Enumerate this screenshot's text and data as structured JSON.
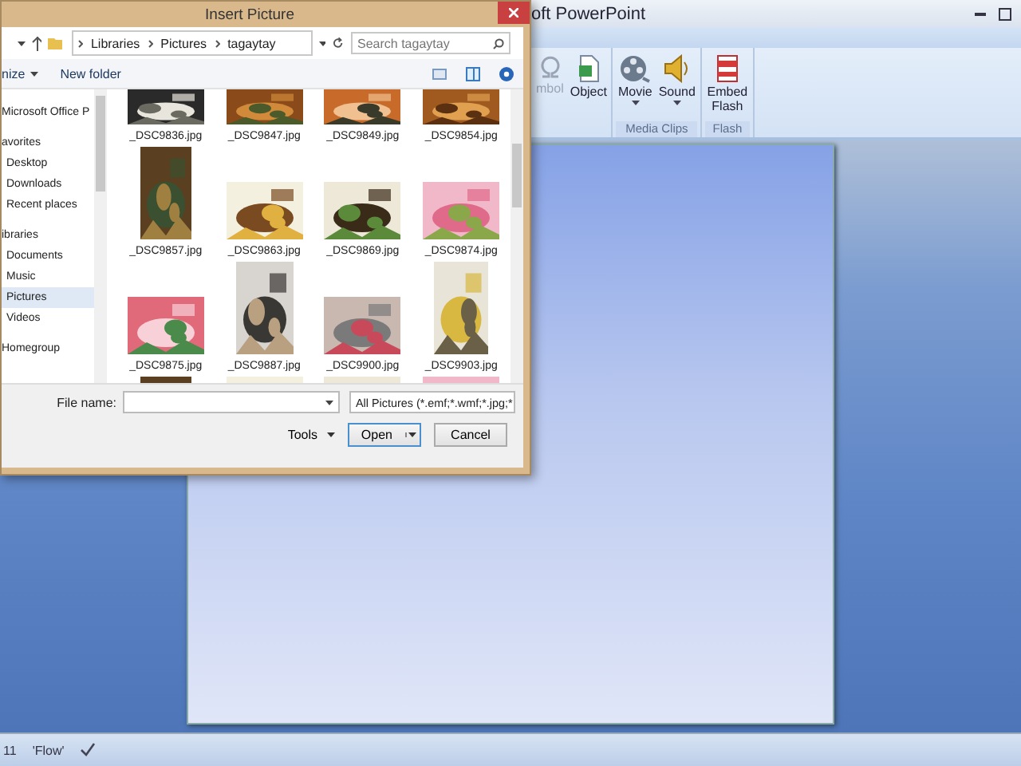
{
  "powerpoint": {
    "title": "oft PowerPoint",
    "ribbon_groups": [
      {
        "items": [
          {
            "label": "mbol",
            "kind": "symbol",
            "disabled": true
          },
          {
            "label": "Object",
            "kind": "object",
            "disabled": false
          }
        ]
      },
      {
        "label": "Media Clips",
        "items": [
          {
            "label": "Movie",
            "kind": "movie",
            "disabled": false,
            "dropdown": true
          },
          {
            "label": "Sound",
            "kind": "sound",
            "disabled": false,
            "dropdown": true
          }
        ]
      },
      {
        "label": "Flash",
        "items": [
          {
            "label": "Embed Flash",
            "kind": "flash",
            "disabled": false
          }
        ]
      }
    ],
    "status_bar": [
      "11",
      "'Flow'"
    ]
  },
  "dialog": {
    "title": "Insert Picture",
    "breadcrumb": [
      "Libraries",
      "Pictures",
      "tagaytay"
    ],
    "search": {
      "placeholder": "Search tagaytay"
    },
    "toolbar": [
      "nize",
      "New folder"
    ],
    "nav": [
      {
        "label": "Microsoft Office P",
        "selected": false
      },
      {
        "label": "avorites",
        "selected": false,
        "children": [
          {
            "label": "Desktop",
            "selected": false
          },
          {
            "label": "Downloads",
            "selected": false
          },
          {
            "label": "Recent places",
            "selected": false
          }
        ]
      },
      {
        "label": "ibraries",
        "selected": false,
        "children": [
          {
            "label": "Documents",
            "selected": false
          },
          {
            "label": "Music",
            "selected": false
          },
          {
            "label": "Pictures",
            "selected": true
          },
          {
            "label": "Videos",
            "selected": false
          }
        ]
      },
      {
        "label": "Homegroup",
        "selected": false
      }
    ],
    "files": [
      {
        "name": "_DSC9836.jpg"
      },
      {
        "name": "_DSC9847.jpg"
      },
      {
        "name": "_DSC9849.jpg"
      },
      {
        "name": "_DSC9854.jpg"
      },
      {
        "name": "_DSC9857.jpg"
      },
      {
        "name": "_DSC9863.jpg"
      },
      {
        "name": "_DSC9869.jpg"
      },
      {
        "name": "_DSC9874.jpg"
      },
      {
        "name": "_DSC9875.jpg"
      },
      {
        "name": "_DSC9887.jpg"
      },
      {
        "name": "_DSC9900.jpg"
      },
      {
        "name": "_DSC9903.jpg"
      }
    ],
    "file_name": {
      "label": "File name:"
    },
    "filter": "All Pictures (*.emf;*.wmf;*.jpg;*",
    "buttons": [
      {
        "label": "Tools",
        "kind": "menu"
      },
      {
        "label": "Open",
        "kind": "split"
      },
      {
        "label": "Cancel",
        "kind": "plain"
      }
    ]
  }
}
